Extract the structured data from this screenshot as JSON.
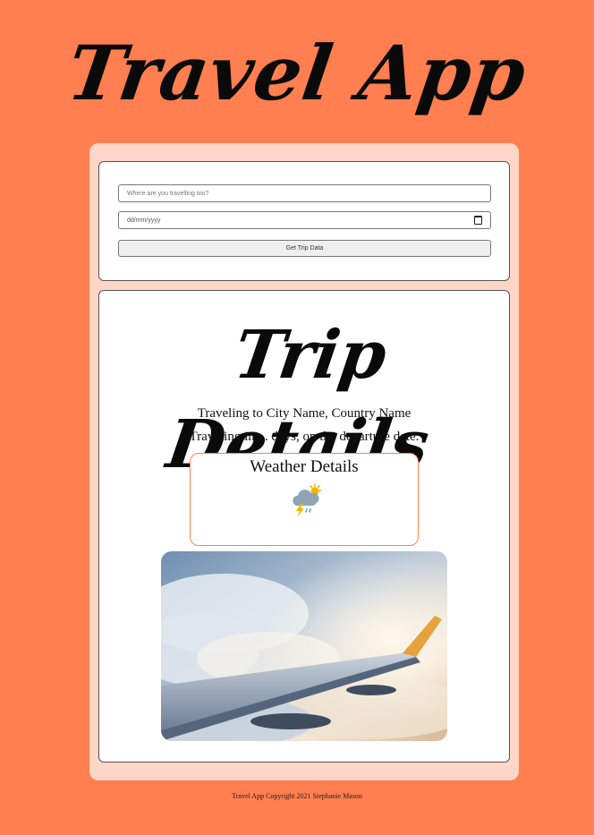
{
  "header": {
    "title": "Travel App"
  },
  "form": {
    "city_placeholder": "Where are you travelling too?",
    "date_placeholder": "dd/mm/yyyy",
    "submit_label": "Get Trip Data"
  },
  "details": {
    "heading": "Trip Details",
    "destination_text": "Traveling to City Name, Country Name",
    "countdown_text": "Traveling in ... days, on the departure date.",
    "weather": {
      "title": "Weather Details",
      "icon": "thunderstorm-sun-icon"
    },
    "image": {
      "subject": "airplane-wing-above-clouds"
    }
  },
  "footer": {
    "copyright": "Travel App Copyright 2021 Stephanie Mason"
  },
  "colors": {
    "background": "#ff7f50",
    "panel": "#ffd6c8",
    "card": "#ffffff",
    "weather_border": "#ff7f50"
  }
}
